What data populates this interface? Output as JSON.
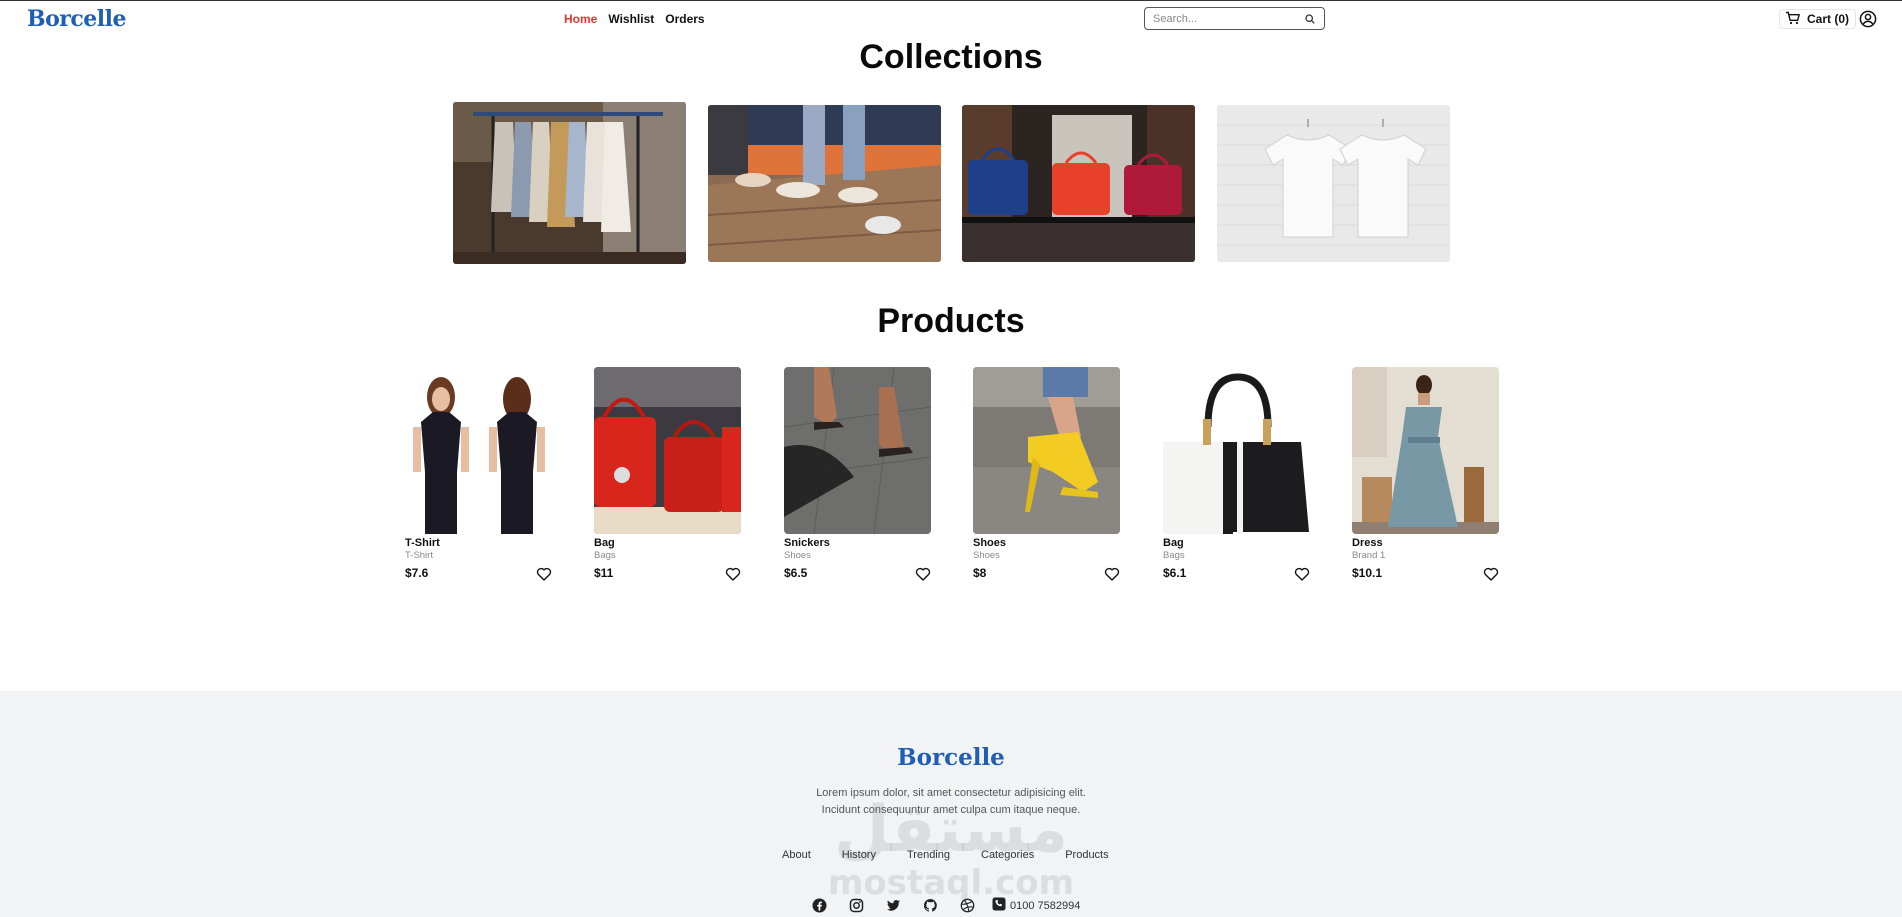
{
  "header": {
    "logo": "Borcelle",
    "nav": [
      "Home",
      "Wishlist",
      "Orders"
    ],
    "active_nav": "Home",
    "search_placeholder": "Search...",
    "cart_label": "Cart (0)"
  },
  "collections": {
    "title": "Collections",
    "items": [
      {
        "icon": "clothing-rack-photo"
      },
      {
        "icon": "shoes-photo"
      },
      {
        "icon": "handbags-photo"
      },
      {
        "icon": "white-tshirts-photo"
      }
    ]
  },
  "products": {
    "title": "Products",
    "items": [
      {
        "name": "T-Shirt",
        "category": "T-Shirt",
        "price": "$7.6",
        "icon": "tshirt-model-photo"
      },
      {
        "name": "Bag",
        "category": "Bags",
        "price": "$11",
        "icon": "red-bags-photo"
      },
      {
        "name": "Snickers",
        "category": "Shoes",
        "price": "$6.5",
        "icon": "sandals-photo"
      },
      {
        "name": "Shoes",
        "category": "Shoes",
        "price": "$8",
        "icon": "yellow-heels-photo"
      },
      {
        "name": "Bag",
        "category": "Bags",
        "price": "$6.1",
        "icon": "black-white-handbag-photo"
      },
      {
        "name": "Dress",
        "category": "Brand 1",
        "price": "$10.1",
        "icon": "dress-model-photo"
      }
    ]
  },
  "footer": {
    "logo": "Borcelle",
    "description_line1": "Lorem ipsum dolor, sit amet consectetur adipisicing elit.",
    "description_line2": "Incidunt consequuntur amet culpa cum itaque neque.",
    "links": [
      "About",
      "History",
      "Trending",
      "Categories",
      "Products"
    ],
    "social": [
      "facebook-icon",
      "instagram-icon",
      "twitter-icon",
      "github-icon",
      "dribbble-icon"
    ],
    "phone": "0100 7582994",
    "watermark_ar": "مستقل",
    "watermark_en": "mostaql.com"
  },
  "colors": {
    "brand": "#1e5fb4",
    "active_nav": "#e0362c",
    "footer_bg": "#f2f3f5"
  }
}
